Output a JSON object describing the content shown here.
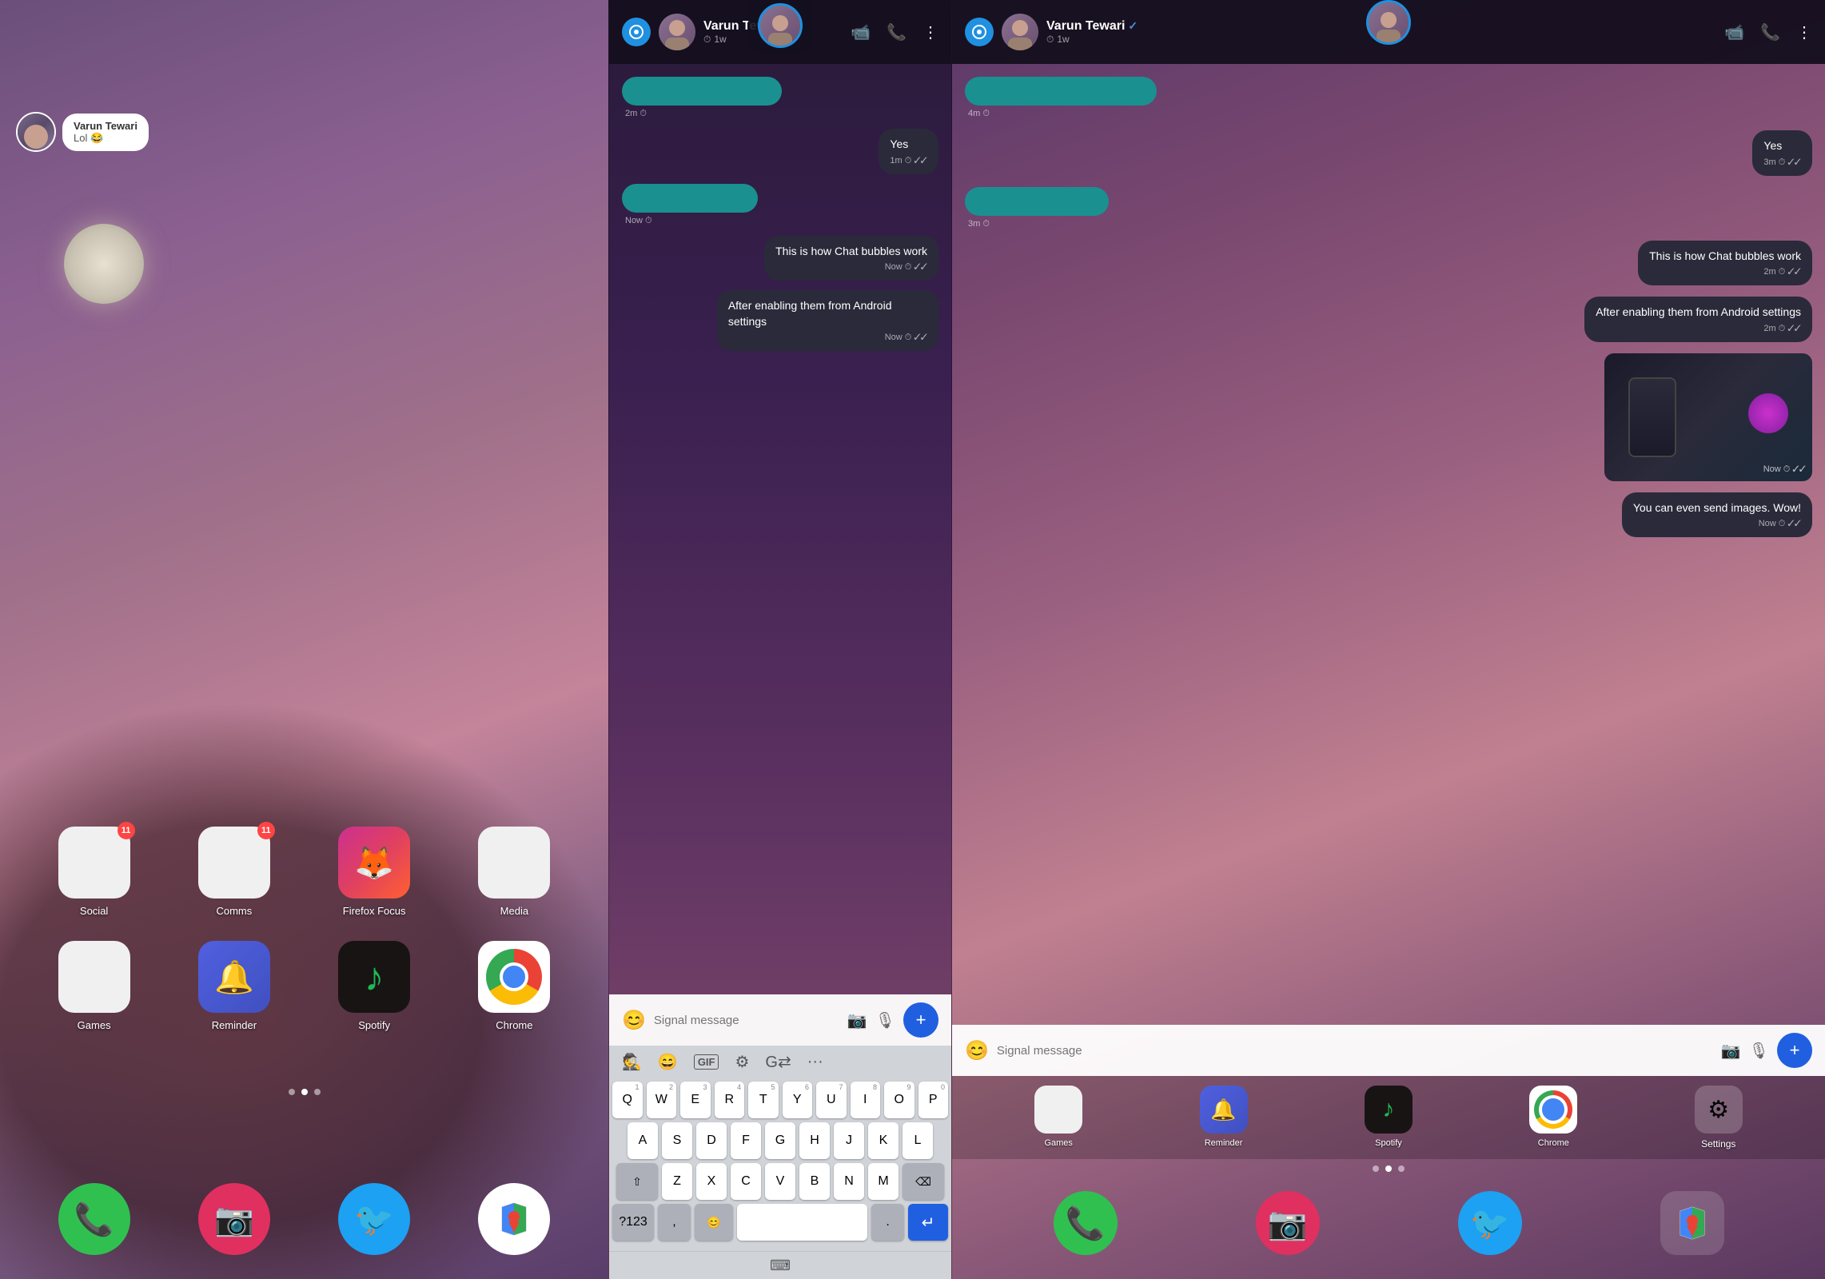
{
  "left_panel": {
    "chat_bubble": {
      "sender": "Varun Tewari",
      "message": "Lol 😂"
    },
    "app_rows": [
      [
        {
          "id": "social",
          "label": "Social",
          "badge": "11",
          "type": "social"
        },
        {
          "id": "comms",
          "label": "Comms",
          "badge": "11",
          "type": "comms"
        },
        {
          "id": "firefox",
          "label": "Firefox Focus",
          "badge": null,
          "type": "firefox"
        },
        {
          "id": "media",
          "label": "Media",
          "badge": null,
          "type": "media"
        }
      ],
      [
        {
          "id": "games",
          "label": "Games",
          "badge": null,
          "type": "games"
        },
        {
          "id": "reminder",
          "label": "Reminder",
          "badge": null,
          "type": "reminder"
        },
        {
          "id": "spotify",
          "label": "Spotify",
          "badge": null,
          "type": "spotify"
        },
        {
          "id": "chrome",
          "label": "Chrome",
          "badge": null,
          "type": "chrome"
        }
      ]
    ],
    "dock": [
      {
        "id": "phone",
        "label": "",
        "type": "phone"
      },
      {
        "id": "camera",
        "label": "",
        "type": "camera"
      },
      {
        "id": "twitter",
        "label": "",
        "type": "twitter"
      },
      {
        "id": "maps",
        "label": "",
        "type": "maps"
      }
    ]
  },
  "middle_panel": {
    "header": {
      "contact_name": "Varun Tewari",
      "status": "1w",
      "verified": true
    },
    "messages": [
      {
        "type": "received",
        "text": "",
        "time": "2m",
        "teal_bar": true
      },
      {
        "type": "sent",
        "text": "Yes",
        "time": "1m"
      },
      {
        "type": "received",
        "text": "",
        "time": "Now",
        "teal_bar": true
      },
      {
        "type": "sent",
        "text": "This is how Chat bubbles work",
        "time": "Now"
      },
      {
        "type": "sent",
        "text": "After enabling them from Android settings",
        "time": "Now"
      }
    ],
    "input_placeholder": "Signal message",
    "keyboard": {
      "rows": [
        [
          "Q",
          "W",
          "E",
          "R",
          "T",
          "Y",
          "U",
          "I",
          "O",
          "P"
        ],
        [
          "A",
          "S",
          "D",
          "F",
          "G",
          "H",
          "J",
          "K",
          "L"
        ],
        [
          "⇧",
          "Z",
          "X",
          "C",
          "V",
          "B",
          "N",
          "M",
          "⌫"
        ],
        [
          "?123",
          ",",
          "😊",
          "",
          ".",
          "↵"
        ]
      ],
      "numbers": [
        "1",
        "2",
        "3",
        "4",
        "5",
        "6",
        "7",
        "8",
        "9",
        "0"
      ]
    }
  },
  "right_panel": {
    "header": {
      "contact_name": "Varun Tewari",
      "status": "1w",
      "verified": true
    },
    "messages": [
      {
        "type": "received",
        "text": "",
        "time": "4m",
        "teal_bar": true
      },
      {
        "type": "sent",
        "text": "Yes",
        "time": "3m"
      },
      {
        "type": "received",
        "text": "",
        "time": "3m",
        "teal_bar": true
      },
      {
        "type": "sent",
        "text": "This is how Chat bubbles work",
        "time": "2m"
      },
      {
        "type": "sent",
        "text": "After enabling them from Android settings",
        "time": "2m"
      },
      {
        "type": "received",
        "text": "[image]",
        "time": "Now",
        "is_image": true
      },
      {
        "type": "sent",
        "text": "You can even send images. Wow!",
        "time": "Now"
      }
    ],
    "input_placeholder": "Signal message",
    "bottom_dock": [
      {
        "label": "Games",
        "type": "games"
      },
      {
        "label": "Reminder",
        "type": "reminder"
      },
      {
        "label": "Spotify",
        "type": "spotify"
      },
      {
        "label": "Chrome",
        "type": "chrome"
      },
      {
        "label": "Settings",
        "type": "settings"
      }
    ]
  },
  "colors": {
    "teal": "#1a9090",
    "sent_bubble": "#2a2a3a",
    "header_bg": "rgba(20,15,30,0.95)",
    "signal_blue": "#2090e0",
    "send_button": "#2060e0"
  }
}
